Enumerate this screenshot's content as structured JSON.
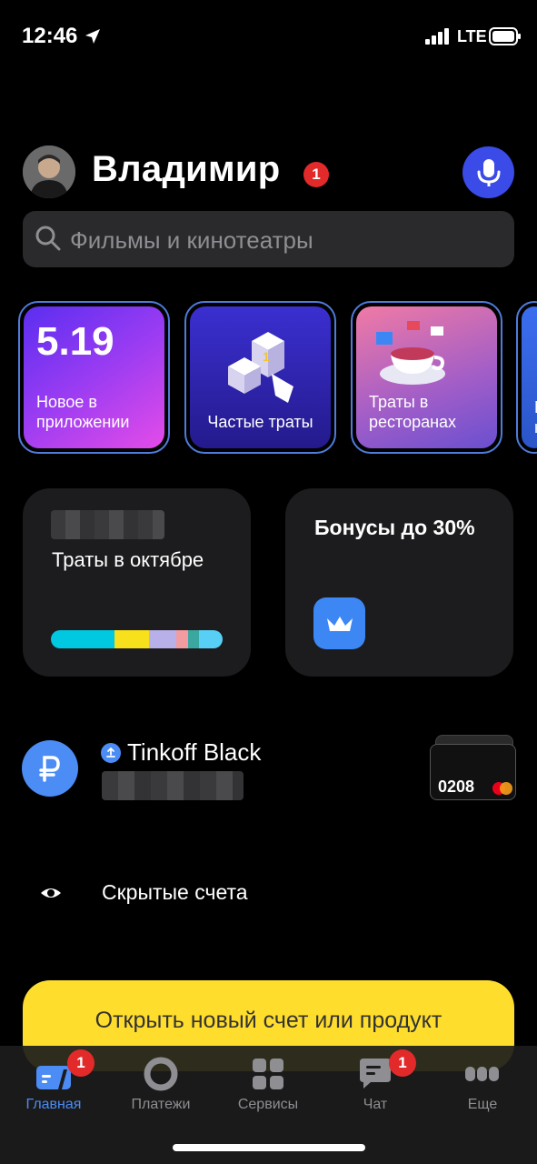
{
  "status_bar": {
    "time": "12:46",
    "network": "LTE"
  },
  "header": {
    "user_name": "Владимир",
    "notification_count": "1"
  },
  "search": {
    "placeholder": "Фильмы и кинотеатры"
  },
  "stories": [
    {
      "big_text": "5.19",
      "label": "Новое в приложении"
    },
    {
      "label": "Частые траты"
    },
    {
      "label": "Траты в ресторанах"
    },
    {
      "label": "В\nн"
    }
  ],
  "tiles": {
    "spending": {
      "label": "Траты в октябре",
      "segments": [
        {
          "color": "#00c8e0",
          "share": 0.37
        },
        {
          "color": "#f7e01c",
          "share": 0.2
        },
        {
          "color": "#b8b0e8",
          "share": 0.16
        },
        {
          "color": "#f29ba0",
          "share": 0.07
        },
        {
          "color": "#3aa8a0",
          "share": 0.06
        },
        {
          "color": "#58d0f5",
          "share": 0.14
        }
      ]
    },
    "bonus": {
      "title": "Бонусы до 30%"
    }
  },
  "account": {
    "name": "Tinkoff Black",
    "card_last4": "0208"
  },
  "hidden_accounts": {
    "label": "Скрытые счета"
  },
  "cta": {
    "label": "Открыть новый счет или продукт"
  },
  "tab_bar": {
    "tabs": [
      {
        "label": "Главная",
        "icon": "home-icon",
        "badge": "1",
        "active": true
      },
      {
        "label": "Платежи",
        "icon": "payments-icon"
      },
      {
        "label": "Сервисы",
        "icon": "services-icon"
      },
      {
        "label": "Чат",
        "icon": "chat-icon",
        "badge": "1"
      },
      {
        "label": "Еще",
        "icon": "more-icon"
      }
    ]
  },
  "colors": {
    "accent_blue": "#4b8cf5",
    "cta_yellow": "#ffdd2d",
    "badge_red": "#e22a2a",
    "mic_blue": "#3a4be8"
  }
}
